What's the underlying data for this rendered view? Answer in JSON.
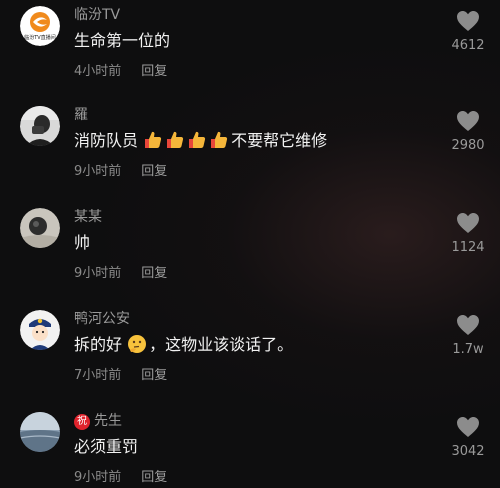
{
  "comments": [
    {
      "username": "临汾TV",
      "text": "生命第一位的",
      "time": "4小时前",
      "reply": "回复",
      "likes": "4612",
      "avatar_icon": "linfen-tv-logo",
      "avatar_logo_caption": "临汾TV直播间"
    },
    {
      "username": "羅",
      "text_prefix": "消防队员",
      "emojis": [
        "thumbs-up",
        "thumbs-up",
        "thumbs-up",
        "thumbs-up"
      ],
      "text_suffix": "不要帮它维修",
      "time": "9小时前",
      "reply": "回复",
      "likes": "2980",
      "avatar_icon": "person-photo-avatar"
    },
    {
      "username": "某某",
      "text": "帅",
      "time": "9小时前",
      "reply": "回复",
      "likes": "1124",
      "avatar_icon": "moon-photo-avatar"
    },
    {
      "username": "鸭河公安",
      "text_prefix": "拆的好",
      "emoji": "thinking-face",
      "text_suffix": "，这物业该谈话了。",
      "time": "7小时前",
      "reply": "回复",
      "likes": "1.7w",
      "avatar_icon": "police-avatar"
    },
    {
      "badge": "祝",
      "username": "先生",
      "text": "必须重罚",
      "time": "9小时前",
      "reply": "回复",
      "likes": "3042",
      "avatar_icon": "landscape-photo-avatar"
    }
  ],
  "colors": {
    "background": "#0e0e0f",
    "username": "#9a9a9a",
    "text": "#f2f2f2",
    "meta": "#8a8a8a",
    "heart": "#8c8c8c",
    "badge": "#e0232c"
  },
  "icons": {
    "like": "heart-icon"
  }
}
